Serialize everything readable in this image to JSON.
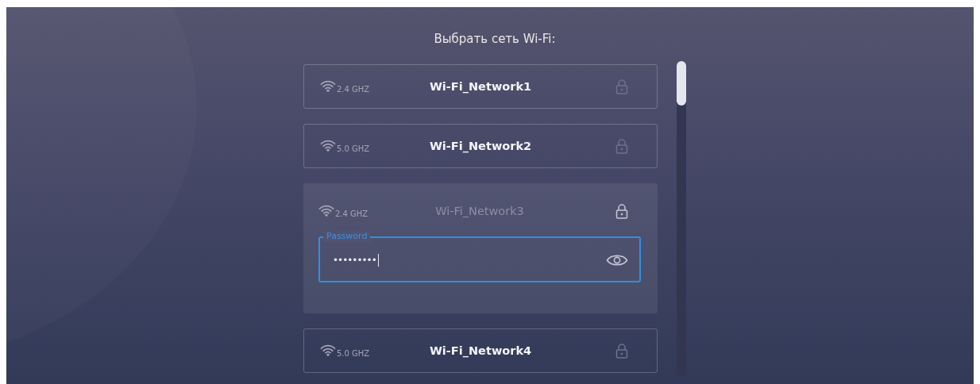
{
  "title": "Выбрать сеть Wi-Fi:",
  "networks": [
    {
      "band": "2.4 GHZ",
      "name": "Wi-Fi_Network1",
      "selected": false
    },
    {
      "band": "5.0 GHZ",
      "name": "Wi-Fi_Network2",
      "selected": false
    },
    {
      "band": "2.4 GHZ",
      "name": "Wi-Fi_Network3",
      "selected": true,
      "password": {
        "label": "Password",
        "value": "•••••••••",
        "focused": true
      }
    },
    {
      "band": "5.0 GHZ",
      "name": "Wi-Fi_Network4",
      "selected": false
    }
  ]
}
